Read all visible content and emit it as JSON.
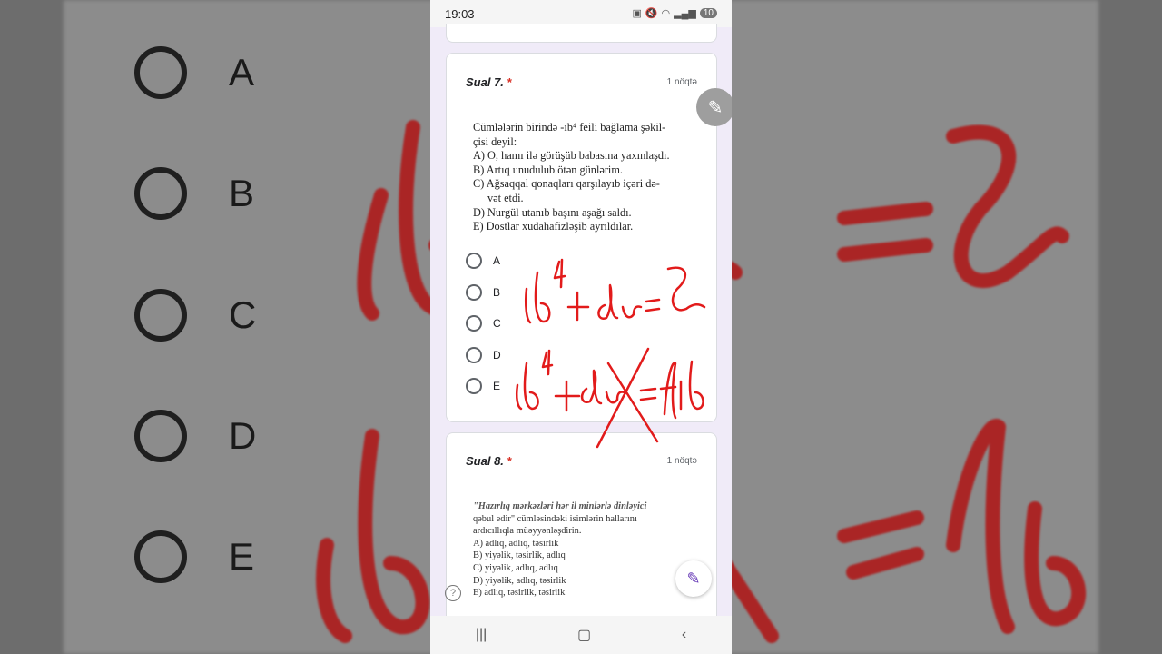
{
  "status_bar": {
    "time": "19:03",
    "battery": "10"
  },
  "background": {
    "options": [
      "A",
      "B",
      "C",
      "D",
      "E"
    ]
  },
  "question7": {
    "title": "Sual 7.",
    "required_mark": "*",
    "points": "1 nöqtə",
    "text_lines": [
      "Cümlələrin birində -ıb⁴ feili bağlama şəkil-",
      "çisi deyil:",
      "A) O, hamı ilə görüşüb babasına yaxınlaşdı.",
      "B) Artıq unudulub ötən günlərim.",
      "C) Ağsaqqal qonaqları qarşılayıb içəri də-",
      "vət etdi.",
      "D) Nurgül utanıb başını aşağı saldı.",
      "E) Dostlar xudahafizləşib ayrıldılar."
    ],
    "options": [
      "A",
      "B",
      "C",
      "D",
      "E"
    ]
  },
  "question8": {
    "title": "Sual 8.",
    "required_mark": "*",
    "points": "1 nöqtə",
    "text_lines": [
      "\"Hazırlıq mərkəzləri hər il minlərlə dinləyici",
      "qəbul edir\" cümləsindəki isimlərin hallarını",
      "ardıcıllıqla müəyyənləşdirin.",
      "A) adlıq, adlıq, təsirlik",
      "B) yiyəlik, təsirlik, adlıq",
      "C) yiyəlik, adlıq, adlıq",
      "D) yiyəlik, adlıq, təsirlik",
      "E) adlıq, təsirlik, təsirlik"
    ]
  },
  "annotations": {
    "line1": "ıb⁴+dır=𝒮",
    "line2": "ıb⁴+dır=fib"
  }
}
